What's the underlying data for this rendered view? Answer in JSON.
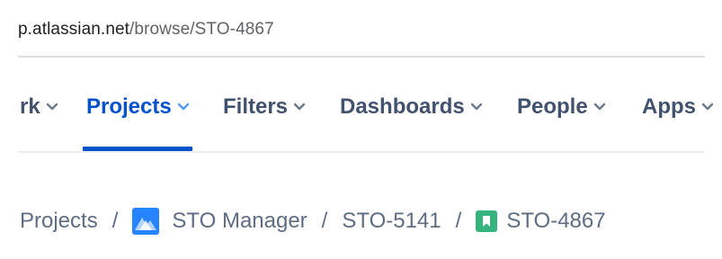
{
  "browser": {
    "url_host": "p.atlassian.net",
    "url_path": "/browse/STO-4867"
  },
  "topnav": {
    "items": [
      {
        "label": "rk",
        "icon": "chevron-down-icon"
      },
      {
        "label": "Projects",
        "icon": "chevron-down-icon",
        "active": true
      },
      {
        "label": "Filters",
        "icon": "chevron-down-icon"
      },
      {
        "label": "Dashboards",
        "icon": "chevron-down-icon"
      },
      {
        "label": "People",
        "icon": "chevron-down-icon"
      },
      {
        "label": "Apps",
        "icon": "chevron-down-icon"
      }
    ],
    "active_color": "#0052cc",
    "text_color": "#42526e"
  },
  "breadcrumb": {
    "projects_label": "Projects",
    "separator": "/",
    "project_name": "STO Manager",
    "project_icon": "project-avatar-icon",
    "parent_issue": "STO-5141",
    "current_issue": "STO-4867",
    "current_issue_icon": "story-icon",
    "story_color": "#36b37e"
  }
}
